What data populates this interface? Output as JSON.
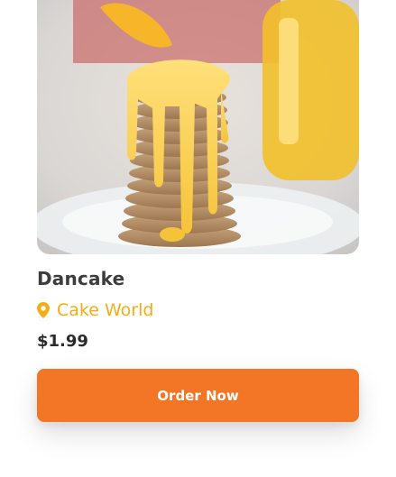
{
  "product": {
    "image_alt": "Stack of pancakes with mango sauce",
    "name": "Dancake",
    "location_icon": "map-pin-icon",
    "location": "Cake World",
    "price": "$1.99"
  },
  "actions": {
    "order_label": "Order Now"
  },
  "colors": {
    "accent": "#f27626",
    "location": "#f5ad17",
    "title": "#3d3d3d",
    "price": "#2b2b2b"
  }
}
